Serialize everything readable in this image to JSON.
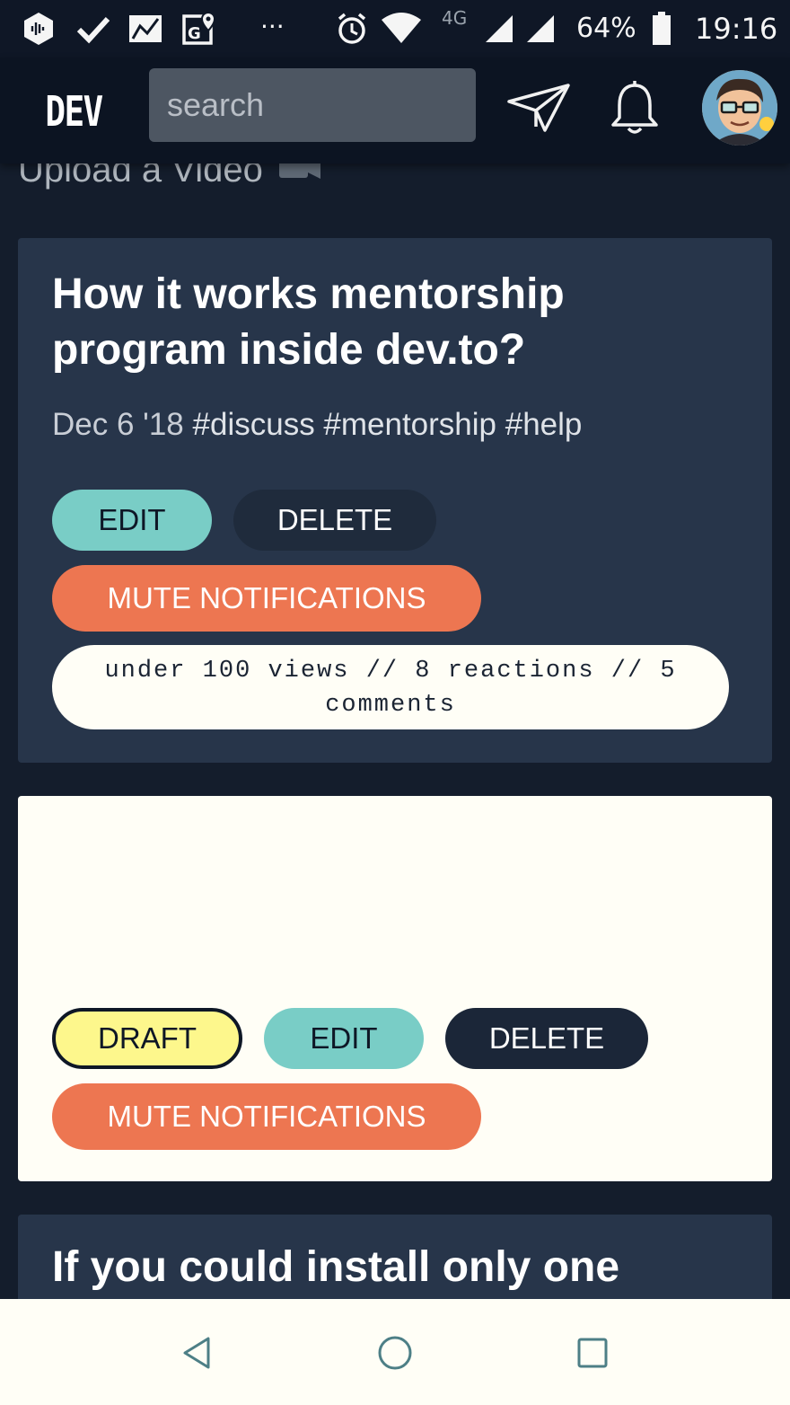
{
  "status_bar": {
    "network_label": "4G",
    "battery": "64%",
    "time": "19:16",
    "more": "···",
    "icons": [
      "app-icon",
      "check-icon",
      "signal-box-icon",
      "maps-icon",
      "alarm-icon",
      "wifi-icon",
      "cell-signal-icon",
      "cell-signal-icon",
      "battery-icon"
    ]
  },
  "header": {
    "logo": "DEV",
    "search_placeholder": "search",
    "icons": [
      "send-icon",
      "bell-icon",
      "avatar"
    ]
  },
  "upload": {
    "label": "Upload a Video",
    "icon": "video-camera-icon"
  },
  "cards": [
    {
      "title": "How it works mentorship program inside dev.to?",
      "date": "Dec 6 '18",
      "tags": "#discuss #mentorship #help",
      "edit_label": "EDIT",
      "delete_label": "DELETE",
      "mute_label": "MUTE NOTIFICATIONS",
      "stats": "under 100 views // 8 reactions // 5 comments"
    },
    {
      "draft_label": "DRAFT",
      "edit_label": "EDIT",
      "delete_label": "DELETE",
      "mute_label": "MUTE NOTIFICATIONS"
    },
    {
      "title": "If you could install only one"
    }
  ],
  "colors": {
    "background": "#141d2c",
    "card_dark": "#27354a",
    "card_light": "#fffef6",
    "edit": "#79cdc6",
    "mute": "#ed7651",
    "draft": "#fdf78c"
  },
  "nav_bar": {
    "icons": [
      "back-icon",
      "home-icon",
      "recents-icon"
    ]
  }
}
